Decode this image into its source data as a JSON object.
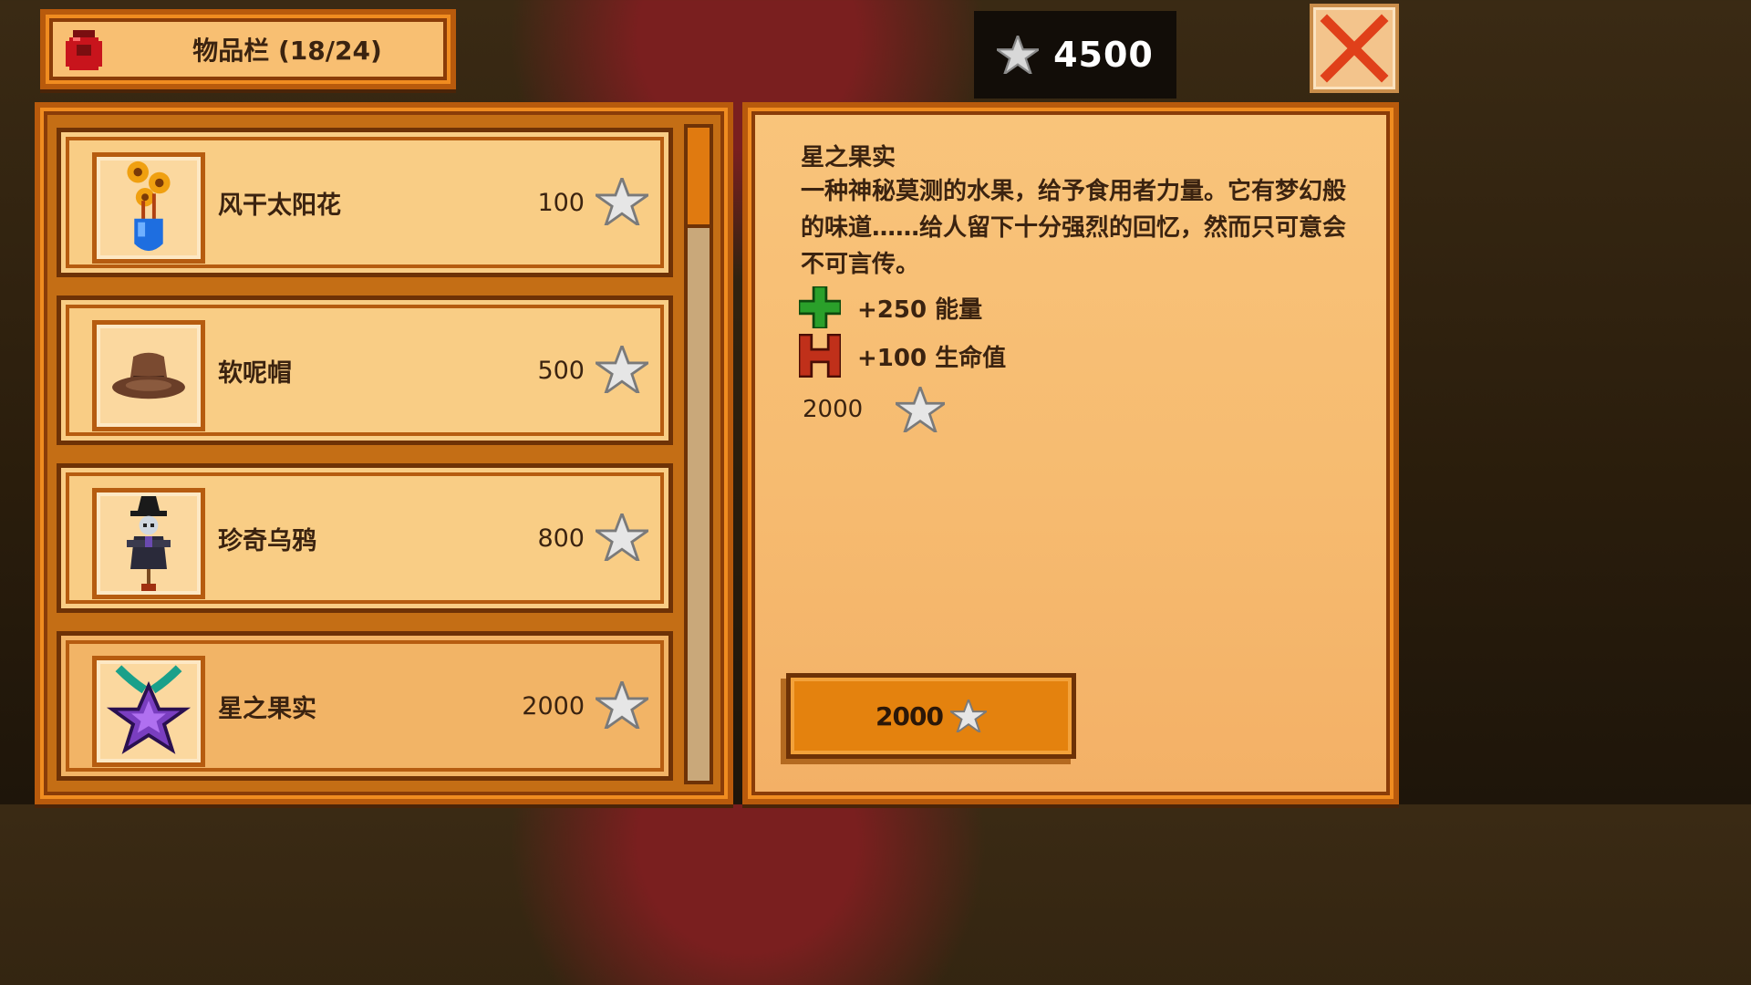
{
  "inventory_tab": {
    "label": "物品栏 (18/24)",
    "icon": "backpack-icon"
  },
  "currency": {
    "amount": "4500",
    "icon": "star-token-icon"
  },
  "close_button": {
    "icon": "close-x-icon",
    "color": "#e0401a"
  },
  "shop_items": [
    {
      "name": "风干太阳花",
      "price": "100",
      "icon": "dried-sunflower-vase-icon",
      "selected": false
    },
    {
      "name": "软呢帽",
      "price": "500",
      "icon": "fedora-hat-icon",
      "selected": false
    },
    {
      "name": "珍奇乌鸦",
      "price": "800",
      "icon": "rarecrow-icon",
      "selected": false
    },
    {
      "name": "星之果实",
      "price": "2000",
      "icon": "stardrop-icon",
      "selected": true
    }
  ],
  "detail": {
    "name": "星之果实",
    "description": "一种神秘莫测的水果，给予食用者力量。它有梦幻般的味道……给人留下十分强烈的回忆，然而只可意会不可言传。",
    "effects": [
      {
        "text": "+250 能量",
        "icon": "energy-plus-icon",
        "color": "#2aa02a"
      },
      {
        "text": "+100 生命值",
        "icon": "health-h-icon",
        "color": "#c0301a"
      }
    ],
    "price": "2000"
  },
  "buy_button": {
    "label": "2000"
  },
  "colors": {
    "accent": "#e4820e",
    "panel": "#f7b866",
    "frame": "#b85a0c",
    "text": "#3b2310"
  }
}
